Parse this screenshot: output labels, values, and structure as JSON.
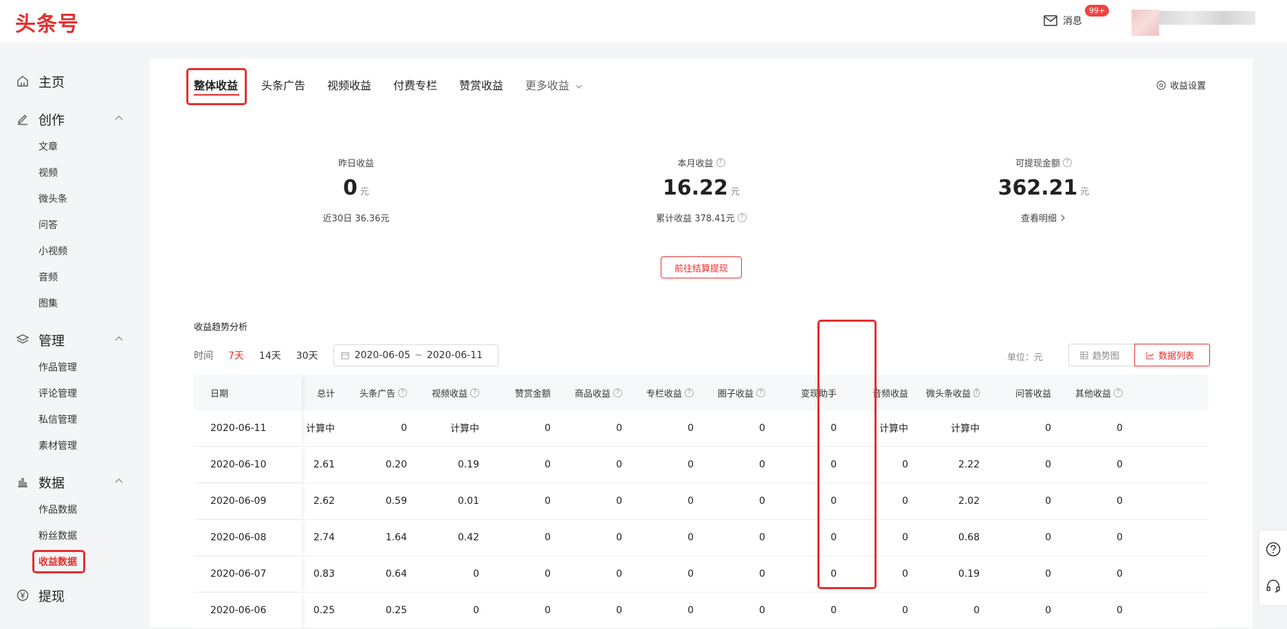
{
  "header": {
    "logo": "头条号",
    "messages_label": "消息",
    "messages_badge": "99+"
  },
  "sidebar": {
    "home": "主页",
    "create": {
      "label": "创作",
      "items": [
        "文章",
        "视频",
        "微头条",
        "问答",
        "小视频",
        "音频",
        "图集"
      ]
    },
    "manage": {
      "label": "管理",
      "items": [
        "作品管理",
        "评论管理",
        "私信管理",
        "素材管理"
      ]
    },
    "data": {
      "label": "数据",
      "items": [
        "作品数据",
        "粉丝数据",
        "收益数据"
      ]
    },
    "withdraw": "提现"
  },
  "tabs": {
    "items": [
      "整体收益",
      "头条广告",
      "视频收益",
      "付费专栏",
      "赞赏收益",
      "更多收益"
    ],
    "active": "整体收益",
    "settings": "收益设置"
  },
  "stats": {
    "yesterday": {
      "label": "昨日收益",
      "value": "0",
      "unit": "元",
      "foot": "近30日 36.36元"
    },
    "month": {
      "label": "本月收益",
      "value": "16.22",
      "unit": "元",
      "foot": "累计收益 378.41元"
    },
    "withdrawable": {
      "label": "可提现金额",
      "value": "362.21",
      "unit": "元",
      "foot": "查看明细"
    },
    "withdraw_button": "前往结算提现"
  },
  "trend": {
    "title": "收益趋势分析",
    "time_label": "时间",
    "ranges": [
      "7天",
      "14天",
      "30天"
    ],
    "active_range": "7天",
    "date_start": "2020-06-05",
    "date_end": "2020-06-11",
    "date_sep": "~",
    "unit": "单位：元",
    "view_chart": "趋势图",
    "view_list": "数据列表"
  },
  "table": {
    "headers": [
      "日期",
      "总计",
      "头条广告",
      "视频收益",
      "赞赏金额",
      "商品收益",
      "专栏收益",
      "圈子收益",
      "变现助手",
      "音频收益",
      "微头条收益",
      "问答收益",
      "其他收益"
    ],
    "rows": [
      [
        "2020-06-11",
        "计算中",
        "0",
        "计算中",
        "0",
        "0",
        "0",
        "0",
        "0",
        "计算中",
        "计算中",
        "0",
        "0"
      ],
      [
        "2020-06-10",
        "2.61",
        "0.20",
        "0.19",
        "0",
        "0",
        "0",
        "0",
        "0",
        "0",
        "2.22",
        "0",
        "0"
      ],
      [
        "2020-06-09",
        "2.62",
        "0.59",
        "0.01",
        "0",
        "0",
        "0",
        "0",
        "0",
        "0",
        "2.02",
        "0",
        "0"
      ],
      [
        "2020-06-08",
        "2.74",
        "1.64",
        "0.42",
        "0",
        "0",
        "0",
        "0",
        "0",
        "0",
        "0.68",
        "0",
        "0"
      ],
      [
        "2020-06-07",
        "0.83",
        "0.64",
        "0",
        "0",
        "0",
        "0",
        "0",
        "0",
        "0",
        "0.19",
        "0",
        "0"
      ],
      [
        "2020-06-06",
        "0.25",
        "0.25",
        "0",
        "0",
        "0",
        "0",
        "0",
        "0",
        "0",
        "0",
        "0",
        "0"
      ]
    ]
  },
  "colors": {
    "accent": "#e52e2e",
    "header_bg": "#f7f8fa",
    "page_bg": "#f4f5f6"
  }
}
